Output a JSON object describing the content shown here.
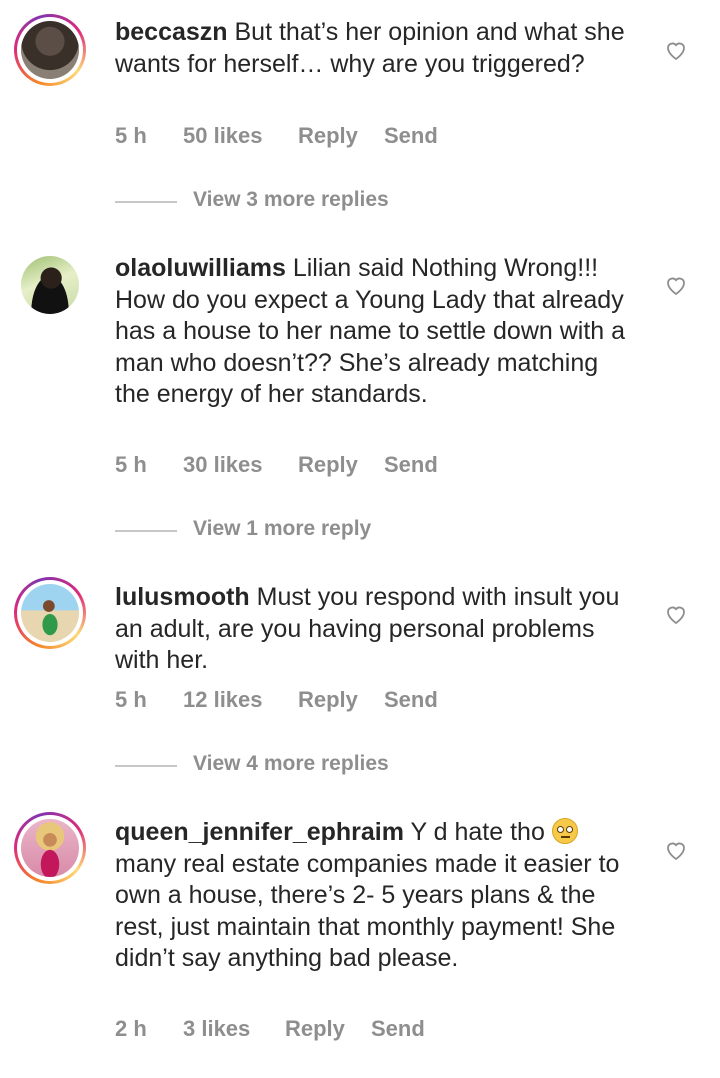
{
  "comments": [
    {
      "username": "beccaszn",
      "text": " But that’s her opinion and what she wants for herself… why are you triggered?",
      "time": "5 h",
      "likes": "50 likes",
      "reply": "Reply",
      "send": "Send",
      "view_replies": "View 3 more replies"
    },
    {
      "username": "olaoluwilliams",
      "text": " Lilian said Nothing Wrong!!! How do you expect a Young Lady that already has a house to her name to settle down with a man who doesn’t?? She’s already matching the energy of her standards.",
      "time": "5 h",
      "likes": "30 likes",
      "reply": "Reply",
      "send": "Send",
      "view_replies": "View 1 more reply"
    },
    {
      "username": "lulusmooth",
      "text": " Must you respond with insult you an adult, are you having personal problems with her.",
      "time": "5 h",
      "likes": "12 likes",
      "reply": "Reply",
      "send": "Send",
      "view_replies": "View 4 more replies"
    },
    {
      "username": "queen_jennifer_ephraim",
      "text_before": " Y d hate tho ",
      "text_after": " many real estate companies made it easier to own a house, there’s 2- 5 years plans & the rest, just maintain that monthly payment! She didn’t say anything bad please.",
      "emoji": "face-with-rolling-eyes",
      "time": "2 h",
      "likes": "3 likes",
      "reply": "Reply",
      "send": "Send"
    }
  ],
  "icons": {
    "like": "heart-outline-icon"
  },
  "colors": {
    "text": "#262626",
    "meta": "#8e8e8e",
    "divider": "#c7c7c7"
  }
}
